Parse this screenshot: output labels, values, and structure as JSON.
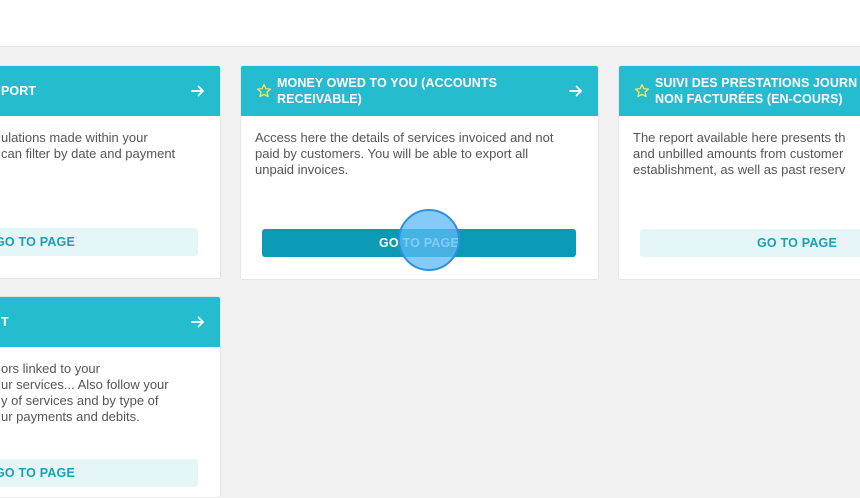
{
  "colors": {
    "header": "#26bcd0",
    "button_primary": "#0b9ab3",
    "button_light": "#e5f6f9",
    "star": "#f5e65a"
  },
  "cards": [
    {
      "title": "PORT",
      "description_lines": [
        "ulations made within your",
        "can filter by date and payment"
      ],
      "button_label": "GO TO PAGE"
    },
    {
      "title_lines": [
        "MONEY OWED TO YOU (ACCOUNTS",
        "RECEIVABLE)"
      ],
      "description_lines": [
        "Access here the details of services invoiced and not",
        "paid by customers. You will be able to export all",
        "unpaid invoices."
      ],
      "button_label": "GO TO PAGE"
    },
    {
      "title_lines": [
        "SUIVI DES PRESTATIONS JOURN",
        "NON FACTURÉES (EN-COURS)"
      ],
      "description_lines": [
        "The report available here presents th",
        "and unbilled amounts from customer",
        "establishment, as well as past reserv"
      ],
      "button_label": "GO TO PAGE"
    },
    {
      "title": "T",
      "description_lines": [
        "ors linked to your",
        "ur services... Also follow your",
        "y of services and by type of",
        "ur payments and debits."
      ],
      "button_label": "GO TO PAGE"
    }
  ]
}
